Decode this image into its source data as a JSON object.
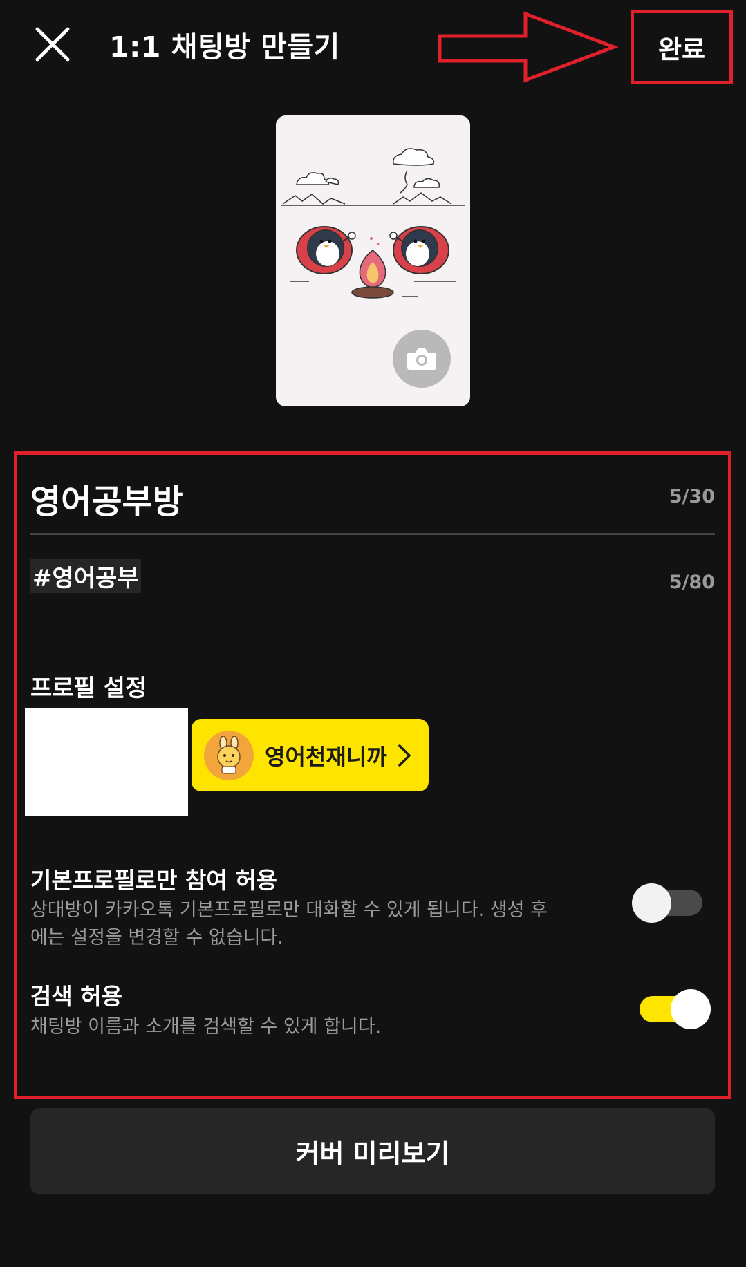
{
  "header": {
    "title": "1:1 채팅방 만들기",
    "done_label": "완료",
    "close_icon": "close-icon"
  },
  "cover": {
    "camera_icon": "camera-icon",
    "illustration": "penguins-campfire-illustration"
  },
  "room": {
    "name": "영어공부방",
    "name_count": "5/30",
    "hashtag": "#영어공부",
    "hashtag_count": "5/80"
  },
  "profile": {
    "section_title": "프로필 설정",
    "nickname": "영어천재니까"
  },
  "options": {
    "default_profile_only": {
      "title": "기본프로필로만 참여 허용",
      "desc_line1": "상대방이 카카오톡 기본프로필로만 대화할 수 있게 됩니다. 생성 후",
      "desc_line2": "에는 설정을 변경할 수 없습니다.",
      "enabled": false
    },
    "search_allowed": {
      "title": "검색 허용",
      "desc": "채팅방 이름과 소개를 검색할 수 있게 합니다.",
      "enabled": true
    }
  },
  "footer": {
    "preview_label": "커버 미리보기"
  },
  "colors": {
    "background": "#121212",
    "accent_yellow": "#fee500",
    "annotation_red": "#e0202a"
  }
}
